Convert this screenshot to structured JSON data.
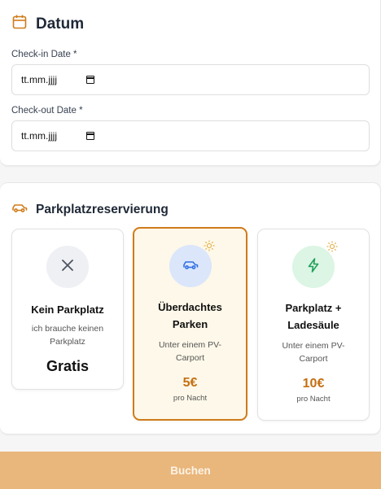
{
  "date_section": {
    "title": "Datum",
    "checkin": {
      "label": "Check-in Date *",
      "value": "tt.mm.jjjj"
    },
    "checkout": {
      "label": "Check-out Date *",
      "value": "tt.mm.jjjj"
    }
  },
  "parking_section": {
    "title": "Parkplatzreservierung",
    "options": [
      {
        "title": "Kein Parkplatz",
        "subtitle": "ich brauche keinen Parkplatz",
        "price": "Gratis",
        "unit": "",
        "selected": false,
        "icon": "close-icon"
      },
      {
        "title": "Überdachtes Parken",
        "subtitle": "Unter einem PV-Carport",
        "price": "5€",
        "unit": "pro Nacht",
        "selected": true,
        "icon": "car-icon"
      },
      {
        "title": "Parkplatz + Ladesäule",
        "subtitle": "Unter einem PV-Carport",
        "price": "10€",
        "unit": "pro Nacht",
        "selected": false,
        "icon": "lightning-icon"
      }
    ]
  },
  "actions": {
    "book_label": "Buchen"
  },
  "colors": {
    "accent": "#d07b1a",
    "button": "#e9b67c",
    "selected_bg": "#fdf8e9"
  }
}
